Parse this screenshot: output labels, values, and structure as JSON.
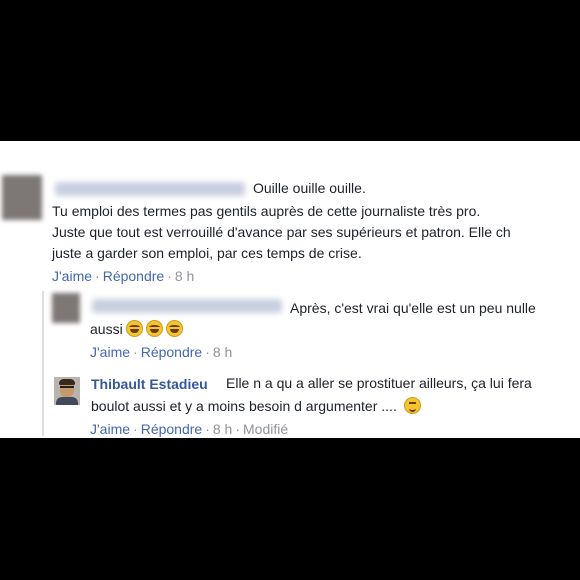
{
  "comments": [
    {
      "author": "",
      "lines": [
        "Ouille ouille ouille.",
        "Tu emploi des termes pas gentils auprès de cette journaliste très pro.",
        "Juste que tout est verrouillé d'avance par ses supérieurs et patron. Elle ch",
        "juste a garder son emploi, par ces temps de crise."
      ],
      "like_label": "J'aime",
      "reply_label": "Répondre",
      "time": "8 h"
    },
    {
      "author": "",
      "lines": [
        "Après, c'est vrai qu'elle est un peu nulle",
        "aussi"
      ],
      "emojis": [
        "laughing-tears",
        "laughing-tears",
        "laughing-tears"
      ],
      "like_label": "J'aime",
      "reply_label": "Répondre",
      "time": "8 h"
    },
    {
      "author": "Thibault Estadieu",
      "lines": [
        "Elle n a qu a aller se prostituer ailleurs, ça lui fera",
        "boulot aussi et y a moins besoin d argumenter ...."
      ],
      "emoji": "wink",
      "like_label": "J'aime",
      "reply_label": "Répondre",
      "time": "8 h",
      "edited_label": "Modifié"
    }
  ],
  "separator": "·"
}
